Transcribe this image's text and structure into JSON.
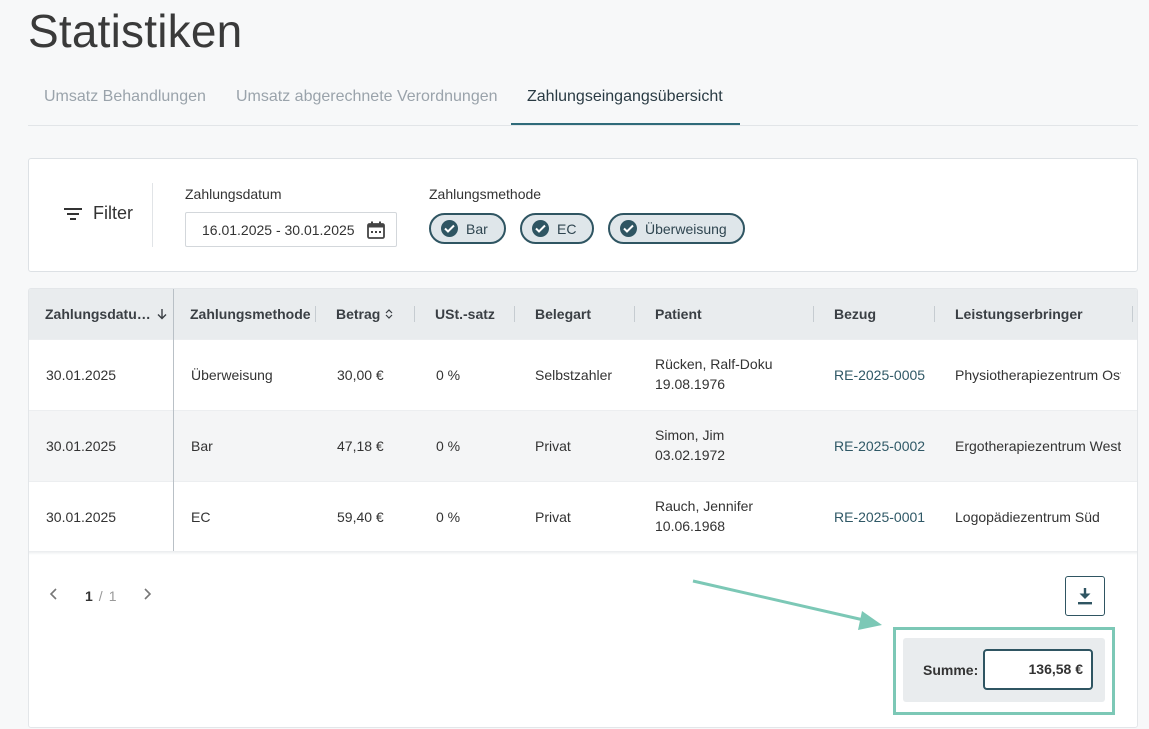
{
  "page": {
    "title": "Statistiken"
  },
  "tabs": [
    {
      "label": "Umsatz Behandlungen"
    },
    {
      "label": "Umsatz abgerechnete Verordnungen"
    },
    {
      "label": "Zahlungseingangsübersicht"
    }
  ],
  "filter": {
    "label": "Filter",
    "date_label": "Zahlungsdatum",
    "date_value": "16.01.2025 - 30.01.2025",
    "method_label": "Zahlungsmethode",
    "chips": [
      {
        "label": "Bar"
      },
      {
        "label": "EC"
      },
      {
        "label": "Überweisung"
      }
    ]
  },
  "table": {
    "columns": [
      "Zahlungsdatu…",
      "Zahlungsmethode",
      "Betrag",
      "USt.-satz",
      "Belegart",
      "Patient",
      "Bezug",
      "Leistungserbringer"
    ],
    "rows": [
      {
        "date": "30.01.2025",
        "method": "Überweisung",
        "amount": "30,00 €",
        "vat": "0 %",
        "type": "Selbstzahler",
        "patient_name": "Rücken, Ralf-Doku",
        "patient_dob": "19.08.1976",
        "ref": "RE-2025-0005",
        "provider": "Physiotherapiezentrum Ost"
      },
      {
        "date": "30.01.2025",
        "method": "Bar",
        "amount": "47,18 €",
        "vat": "0 %",
        "type": "Privat",
        "patient_name": "Simon, Jim",
        "patient_dob": "03.02.1972",
        "ref": "RE-2025-0002",
        "provider": "Ergotherapiezentrum West"
      },
      {
        "date": "30.01.2025",
        "method": "EC",
        "amount": "59,40 €",
        "vat": "0 %",
        "type": "Privat",
        "patient_name": "Rauch, Jennifer",
        "patient_dob": "10.06.1968",
        "ref": "RE-2025-0001",
        "provider": "Logopädiezentrum Süd"
      }
    ]
  },
  "pagination": {
    "current": "1",
    "separator": "/",
    "total": "1"
  },
  "summary": {
    "label": "Summe:",
    "value": "136,58 €"
  },
  "colors": {
    "accent": "#2f5562",
    "highlight": "#7cc8b6"
  },
  "icons": {
    "filter": "filter-lines-icon",
    "calendar": "calendar-icon",
    "check": "check-circle-icon",
    "download": "download-icon",
    "sort_desc": "arrow-down-icon",
    "sort": "sort-icon"
  }
}
